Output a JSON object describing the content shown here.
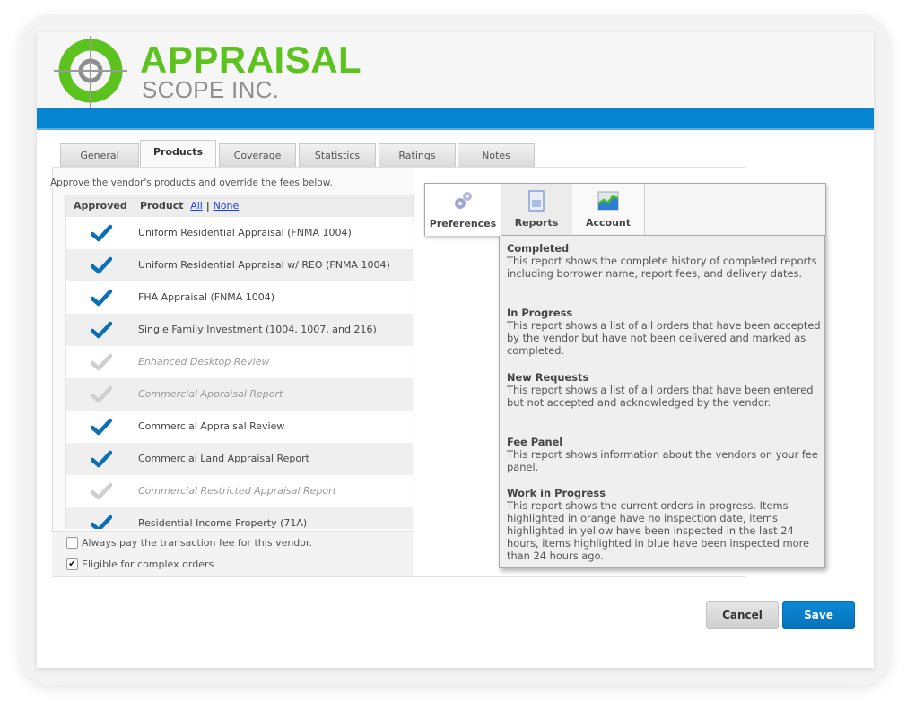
{
  "brand": {
    "name_line1": "APPRAISAL",
    "name_line2": "SCOPE INC.",
    "accent_green": "#5cc21e",
    "bar_blue": "#0584d1"
  },
  "tabs": [
    {
      "label": "General",
      "active": false
    },
    {
      "label": "Products",
      "active": true
    },
    {
      "label": "Coverage",
      "active": false
    },
    {
      "label": "Statistics",
      "active": false
    },
    {
      "label": "Ratings",
      "active": false
    },
    {
      "label": "Notes",
      "active": false
    }
  ],
  "products": {
    "intro": "Approve the vendor's products and override the fees below.",
    "col_approved": "Approved",
    "col_product": "Product",
    "link_all": "All",
    "link_sep": "|",
    "link_none": "None",
    "rows": [
      {
        "label": "Uniform Residential Appraisal (FNMA 1004)",
        "approved": true
      },
      {
        "label": "Uniform Residential Appraisal w/ REO (FNMA 1004)",
        "approved": true
      },
      {
        "label": "FHA Appraisal (FNMA 1004)",
        "approved": true
      },
      {
        "label": "Single Family Investment (1004, 1007, and 216)",
        "approved": true
      },
      {
        "label": "Enhanced Desktop Review",
        "approved": false
      },
      {
        "label": "Commercial Appraisal Report",
        "approved": false
      },
      {
        "label": "Commercial Appraisal Review",
        "approved": true
      },
      {
        "label": "Commercial Land Appraisal Report",
        "approved": true
      },
      {
        "label": "Commercial Restricted Appraisal Report",
        "approved": false
      },
      {
        "label": "Residential Income Property (71A)",
        "approved": true
      }
    ],
    "options": [
      {
        "label": "Always pay the transaction fee for this vendor.",
        "checked": false
      },
      {
        "label": "Eligible for complex orders",
        "checked": true
      }
    ]
  },
  "menu": {
    "tabs": [
      {
        "label": "Preferences",
        "icon": "gears-icon"
      },
      {
        "label": "Reports",
        "icon": "report-document-icon"
      },
      {
        "label": "Account",
        "icon": "chart-icon"
      }
    ],
    "reports": [
      {
        "title": "Completed",
        "desc": "This report shows the complete history of completed reports including borrower name, report fees, and delivery dates."
      },
      {
        "title": "In Progress",
        "desc": "This report shows a list of all orders that have been accepted by the vendor but have not been delivered and marked as completed."
      },
      {
        "title": "New Requests",
        "desc": "This report shows a list of all orders that have been entered but not accepted and acknowledged by the vendor."
      },
      {
        "title": "Fee Panel",
        "desc": "This report shows information about the vendors on your fee panel."
      },
      {
        "title": "Work in Progress",
        "desc": "This report shows the current orders in progress. Items highlighted in orange have no inspection date, items highlighted in yellow have been inspected in the last 24 hours, items highlighted in blue have been inspected more than 24 hours ago."
      }
    ]
  },
  "actions": {
    "cancel": "Cancel",
    "save": "Save"
  }
}
